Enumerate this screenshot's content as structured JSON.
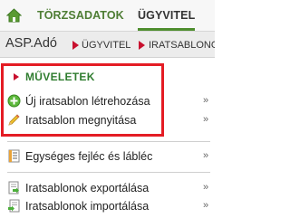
{
  "tabs": {
    "torzsadatok": "TÖRZSADATOK",
    "ugyvitel": "ÜGYVITEL"
  },
  "breadcrumb": {
    "app": "ASP.Adó",
    "level1": "ÜGYVITEL",
    "level2": "IRATSABLONOK"
  },
  "menu": {
    "section_title": "MŰVELETEK",
    "items": [
      {
        "label": "Új iratsablon létrehozása",
        "icon": "add-icon"
      },
      {
        "label": "Iratsablon megnyitása",
        "icon": "pencil-icon"
      },
      {
        "label": "Egységes fejléc és lábléc",
        "icon": "document-list-icon"
      },
      {
        "label": "Iratsablonok exportálása",
        "icon": "document-export-icon"
      },
      {
        "label": "Iratsablonok importálása",
        "icon": "document-import-icon"
      }
    ],
    "chevron": "»"
  },
  "colors": {
    "accent_green": "#4e7d34",
    "breadcrumb_arrow": "#c8102e",
    "highlight_red": "#e41c24"
  }
}
